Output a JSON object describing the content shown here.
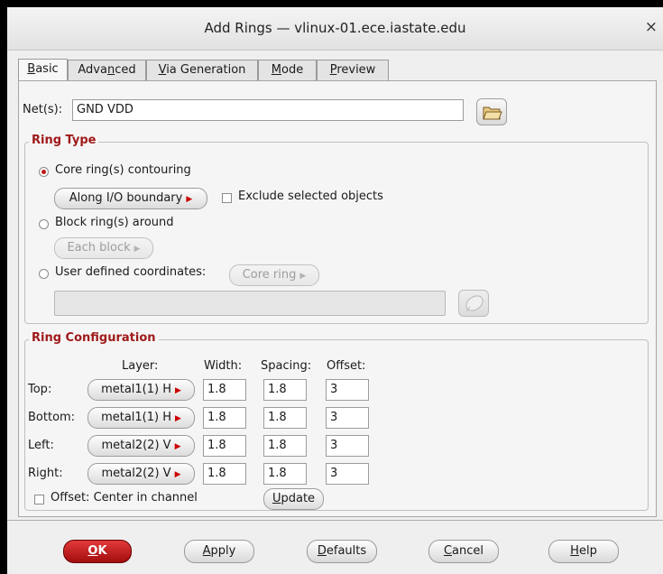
{
  "window": {
    "title": "Add Rings — vlinux-01.ece.iastate.edu",
    "close_glyph": "×"
  },
  "tabs": [
    {
      "pre": "",
      "key": "B",
      "post": "asic"
    },
    {
      "pre": "Adva",
      "key": "n",
      "post": "ced"
    },
    {
      "pre": "",
      "key": "V",
      "post": "ia Generation"
    },
    {
      "pre": "",
      "key": "M",
      "post": "ode"
    },
    {
      "pre": "",
      "key": "P",
      "post": "review"
    }
  ],
  "nets": {
    "label": "Net(s):",
    "value": "GND VDD",
    "browse_icon": "folder-icon"
  },
  "ring_type": {
    "title": "Ring Type",
    "core_label": "Core ring(s) contouring",
    "core_button": "Along I/O boundary",
    "exclude_label": "Exclude selected objects",
    "block_label": "Block ring(s) around",
    "block_button": "Each block",
    "user_label": "User defined coordinates:",
    "user_button": "Core ring",
    "coords_value": "",
    "pick_icon": "mouse-icon"
  },
  "ring_config": {
    "title": "Ring Configuration",
    "headers": {
      "layer": "Layer:",
      "width": "Width:",
      "spacing": "Spacing:",
      "offset": "Offset:"
    },
    "rows": [
      {
        "side": "Top:",
        "layer": "metal1(1) H",
        "width": "1.8",
        "spacing": "1.8",
        "offset": "3"
      },
      {
        "side": "Bottom:",
        "layer": "metal1(1) H",
        "width": "1.8",
        "spacing": "1.8",
        "offset": "3"
      },
      {
        "side": "Left:",
        "layer": "metal2(2) V",
        "width": "1.8",
        "spacing": "1.8",
        "offset": "3"
      },
      {
        "side": "Right:",
        "layer": "metal2(2) V",
        "width": "1.8",
        "spacing": "1.8",
        "offset": "3"
      }
    ],
    "offset_center_label": "Offset: Center in channel",
    "update": {
      "key": "U",
      "post": "pdate"
    }
  },
  "buttons": {
    "ok": {
      "pre": "",
      "key": "O",
      "post": "K"
    },
    "apply": {
      "pre": "",
      "key": "A",
      "post": "pply"
    },
    "defaults": {
      "pre": "",
      "key": "D",
      "post": "efaults"
    },
    "cancel": {
      "pre": "",
      "key": "C",
      "post": "ancel"
    },
    "help": {
      "pre": "",
      "key": "H",
      "post": "elp"
    }
  }
}
